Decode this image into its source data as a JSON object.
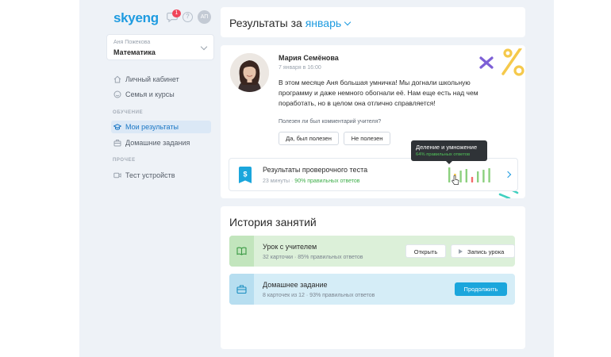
{
  "header": {
    "logo_text": "skyeng",
    "notifications_count": "1",
    "help_label": "?",
    "user_initials": "АП"
  },
  "student": {
    "name": "Аня Пожекова",
    "subject": "Математика"
  },
  "nav": {
    "items_top": [
      {
        "label": "Личный кабинет",
        "icon": "home-icon"
      },
      {
        "label": "Семья и курсы",
        "icon": "smile-icon"
      }
    ],
    "section_learning": "ОБУЧЕНИЕ",
    "items_learning": [
      {
        "label": "Мои результаты",
        "icon": "graduation-cap-icon",
        "active": true
      },
      {
        "label": "Домашние задания",
        "icon": "briefcase-icon"
      }
    ],
    "section_other": "ПРОЧЕЕ",
    "items_other": [
      {
        "label": "Тест устройств",
        "icon": "camera-icon"
      }
    ]
  },
  "results": {
    "title_prefix": "Результаты за",
    "month": "январь"
  },
  "comment": {
    "teacher_name": "Мария Семёнова",
    "date": "7 января в 16:00",
    "text": "В этом месяце Аня большая умничка! Мы догнали школьную программу и даже немного обогнали её. Нам еще есть над чем поработать, но в целом она отлично справляется!",
    "helpful_question": "Полезен ли был комментарий учителя?",
    "btn_yes": "Да, был полезен",
    "btn_no": "Не полезен"
  },
  "test": {
    "title": "Результаты проверочного теста",
    "duration": "23 минуты",
    "separator": " · ",
    "correct": "90% правильных ответов",
    "bars": [
      {
        "value": 0.95,
        "color": "#8cd07e"
      },
      {
        "value": 0.55,
        "color": "#f0c33c"
      },
      {
        "value": 0.75,
        "color": "#8cd07e"
      },
      {
        "value": 0.85,
        "color": "#8cd07e"
      },
      {
        "value": 0.35,
        "color": "#f46b6b"
      },
      {
        "value": 0.7,
        "color": "#8cd07e"
      },
      {
        "value": 0.8,
        "color": "#8cd07e"
      },
      {
        "value": 0.9,
        "color": "#8cd07e"
      }
    ],
    "tooltip_title": "Деление и умножение",
    "tooltip_value": "64% правильных ответов"
  },
  "history": {
    "title": "История занятий",
    "lessons": [
      {
        "title": "Урок с учителем",
        "meta": "32 карточки · 85% правильных ответов",
        "btn_open": "Открыть",
        "btn_record": "Запись урока",
        "icon": "book-icon"
      },
      {
        "title": "Домашнее задание",
        "meta": "8 карточек из 12 · 93% правильных ответов",
        "btn_continue": "Продолжить",
        "icon": "briefcase-icon"
      }
    ]
  },
  "colors": {
    "brand": "#1e9be0",
    "lesson_green": "#dcf0d9",
    "homework_blue": "#d5edf7",
    "continue_button": "#1ba6dc"
  }
}
